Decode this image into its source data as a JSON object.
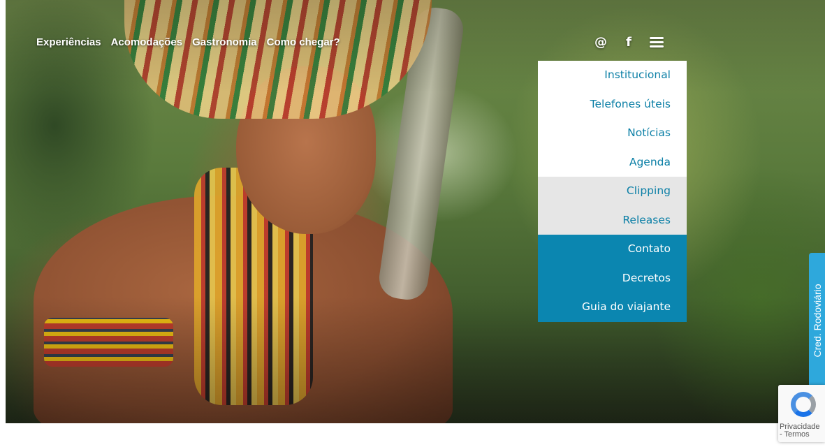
{
  "nav": {
    "links": [
      "Experiências",
      "Acomodações",
      "Gastronomia",
      "Como chegar?"
    ]
  },
  "top_icons": {
    "instagram": "@",
    "facebook": "f",
    "menu_icon": "hamburger-icon"
  },
  "dropdown": {
    "items": [
      {
        "label": "Institucional",
        "style": "white"
      },
      {
        "label": "Telefones úteis",
        "style": "white"
      },
      {
        "label": "Notícias",
        "style": "white"
      },
      {
        "label": "Agenda",
        "style": "white"
      },
      {
        "label": "Clipping",
        "style": "grey"
      },
      {
        "label": "Releases",
        "style": "grey"
      },
      {
        "label": "Contato",
        "style": "blue"
      },
      {
        "label": "Decretos",
        "style": "blue"
      },
      {
        "label": "Guia do viajante",
        "style": "blue"
      }
    ]
  },
  "side_tab": {
    "label": "Cred. Rodoviário"
  },
  "recaptcha": {
    "line1": "Privacidade",
    "line2": "- Termos"
  },
  "colors": {
    "link_blue": "#0b7fa6",
    "menu_blue": "#0b86b0",
    "menu_grey": "#e6e6e6",
    "side_tab": "#2ea8dc"
  }
}
